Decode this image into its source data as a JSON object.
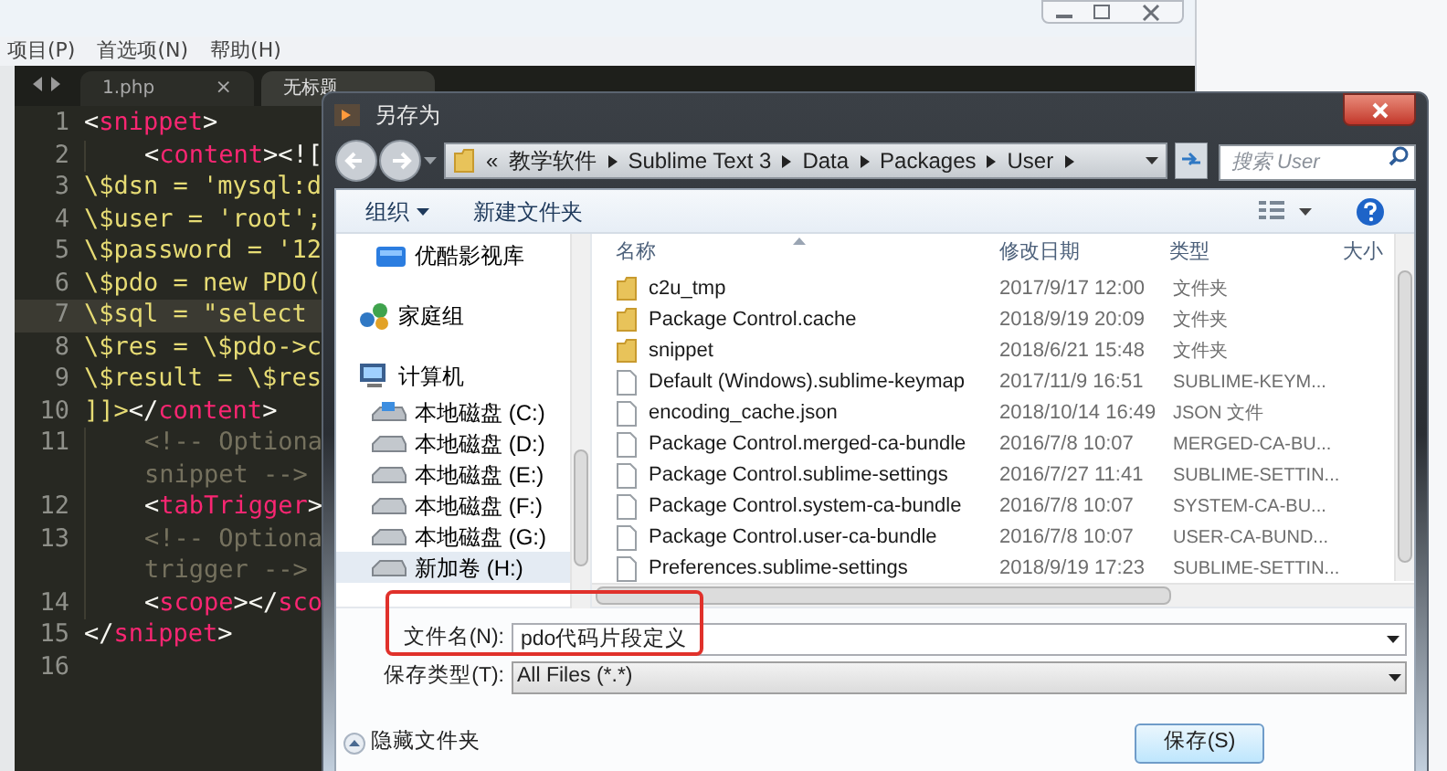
{
  "menu": [
    "项目(P)",
    "首选项(N)",
    "帮助(H)"
  ],
  "tabs": [
    {
      "label": "1.php",
      "selected": false,
      "close": "×"
    },
    {
      "label": "无标题",
      "selected": true
    }
  ],
  "editor": {
    "lines": [
      {
        "number": "1",
        "current": false,
        "indent": false,
        "tokens": [
          {
            "kind": "punct",
            "t": "<"
          },
          {
            "kind": "tag",
            "t": "snippet"
          },
          {
            "kind": "punct",
            "t": ">"
          }
        ]
      },
      {
        "number": "2",
        "current": false,
        "indent": true,
        "tokens": [
          {
            "kind": "punct",
            "t": "<"
          },
          {
            "kind": "tag",
            "t": "content"
          },
          {
            "kind": "punct",
            "t": "><!["
          }
        ]
      },
      {
        "number": "3",
        "current": false,
        "indent": false,
        "tokens": [
          {
            "kind": "string",
            "t": "\\$dsn = 'mysql:d"
          }
        ]
      },
      {
        "number": "4",
        "current": false,
        "indent": false,
        "tokens": [
          {
            "kind": "string",
            "t": "\\$user = 'root';"
          }
        ]
      },
      {
        "number": "5",
        "current": false,
        "indent": false,
        "tokens": [
          {
            "kind": "string",
            "t": "\\$password = '12"
          }
        ]
      },
      {
        "number": "6",
        "current": false,
        "indent": false,
        "tokens": [
          {
            "kind": "string",
            "t": "\\$pdo = new PDO("
          }
        ]
      },
      {
        "number": "7",
        "current": true,
        "indent": false,
        "tokens": [
          {
            "kind": "string",
            "t": "\\$sql = \"select"
          }
        ]
      },
      {
        "number": "8",
        "current": false,
        "indent": false,
        "tokens": [
          {
            "kind": "string",
            "t": "\\$res = \\$pdo->c"
          }
        ]
      },
      {
        "number": "9",
        "current": false,
        "indent": false,
        "tokens": [
          {
            "kind": "string",
            "t": "\\$result = \\$res"
          }
        ]
      },
      {
        "number": "10",
        "current": false,
        "indent": false,
        "tokens": [
          {
            "kind": "string",
            "t": "]]>"
          },
          {
            "kind": "punct",
            "t": "</"
          },
          {
            "kind": "tag",
            "t": "content"
          },
          {
            "kind": "punct",
            "t": ">"
          }
        ]
      },
      {
        "number": "11",
        "current": false,
        "indent": true,
        "tokens": [
          {
            "kind": "comment",
            "t": "<!-- Optiona"
          }
        ],
        "wrap": [
          {
            "kind": "comment",
            "t": "snippet -->"
          }
        ]
      },
      {
        "number": "12",
        "current": false,
        "indent": true,
        "tokens": [
          {
            "kind": "punct",
            "t": "<"
          },
          {
            "kind": "tag",
            "t": "tabTrigger"
          },
          {
            "kind": "punct",
            "t": ">"
          }
        ]
      },
      {
        "number": "13",
        "current": false,
        "indent": true,
        "tokens": [
          {
            "kind": "comment",
            "t": "<!-- Optiona"
          }
        ],
        "wrap": [
          {
            "kind": "comment",
            "t": "trigger -->"
          }
        ]
      },
      {
        "number": "14",
        "current": false,
        "indent": true,
        "tokens": [
          {
            "kind": "punct",
            "t": "<"
          },
          {
            "kind": "tag",
            "t": "scope"
          },
          {
            "kind": "punct",
            "t": "></"
          },
          {
            "kind": "tag",
            "t": "sco"
          }
        ]
      },
      {
        "number": "15",
        "current": false,
        "indent": false,
        "tokens": [
          {
            "kind": "punct",
            "t": "</"
          },
          {
            "kind": "tag",
            "t": "snippet"
          },
          {
            "kind": "punct",
            "t": ">"
          }
        ]
      },
      {
        "number": "16",
        "current": false
      }
    ]
  },
  "dialog": {
    "title": "另存为",
    "path": [
      "«",
      "教学软件",
      "Sublime Text 3",
      "Data",
      "Packages",
      "User"
    ],
    "search": {
      "placeholder": "搜索 User"
    },
    "toolbar": {
      "organize": "组织",
      "new_folder": "新建文件夹"
    },
    "nav": [
      {
        "label": "优酷影视库",
        "kind": "library",
        "selected": false
      },
      {
        "label": "家庭组",
        "kind": "homegroup",
        "selected": false
      },
      {
        "label": "计算机",
        "kind": "computer",
        "selected": false,
        "children": [
          {
            "label": "本地磁盘 (C:)",
            "kind": "system-drive",
            "selected": false
          },
          {
            "label": "本地磁盘 (D:)",
            "kind": "drive",
            "selected": false
          },
          {
            "label": "本地磁盘 (E:)",
            "kind": "drive",
            "selected": false
          },
          {
            "label": "本地磁盘 (F:)",
            "kind": "drive",
            "selected": false
          },
          {
            "label": "本地磁盘 (G:)",
            "kind": "drive",
            "selected": false
          },
          {
            "label": "新加卷 (H:)",
            "kind": "drive",
            "selected": true
          }
        ]
      }
    ],
    "columns": [
      "名称",
      "修改日期",
      "类型",
      "大小"
    ],
    "files": [
      {
        "name": "c2u_tmp",
        "date": "2017/9/17 12:00",
        "type": "文件夹",
        "kind": "folder"
      },
      {
        "name": "Package Control.cache",
        "date": "2018/9/19 20:09",
        "type": "文件夹",
        "kind": "folder"
      },
      {
        "name": "snippet",
        "date": "2018/6/21 15:48",
        "type": "文件夹",
        "kind": "folder"
      },
      {
        "name": "Default (Windows).sublime-keymap",
        "date": "2017/11/9 16:51",
        "type": "SUBLIME-KEYM...",
        "kind": "file"
      },
      {
        "name": "encoding_cache.json",
        "date": "2018/10/14 16:49",
        "type": "JSON 文件",
        "kind": "file"
      },
      {
        "name": "Package Control.merged-ca-bundle",
        "date": "2016/7/8 10:07",
        "type": "MERGED-CA-BU...",
        "kind": "file"
      },
      {
        "name": "Package Control.sublime-settings",
        "date": "2016/7/27 11:41",
        "type": "SUBLIME-SETTIN...",
        "kind": "file"
      },
      {
        "name": "Package Control.system-ca-bundle",
        "date": "2016/7/8 10:07",
        "type": "SYSTEM-CA-BU...",
        "kind": "file"
      },
      {
        "name": "Package Control.user-ca-bundle",
        "date": "2016/7/8 10:07",
        "type": "USER-CA-BUND...",
        "kind": "file"
      },
      {
        "name": "Preferences.sublime-settings",
        "date": "2018/9/19 17:23",
        "type": "SUBLIME-SETTIN...",
        "kind": "file"
      }
    ],
    "filename": {
      "label": "文件名(N):",
      "value": "pdo代码片段定义",
      "highlighted": true
    },
    "filetype": {
      "label": "保存类型(T):",
      "value": "All Files (*.*)"
    },
    "hide_folders": "隐藏文件夹",
    "save": "保存(S)"
  }
}
